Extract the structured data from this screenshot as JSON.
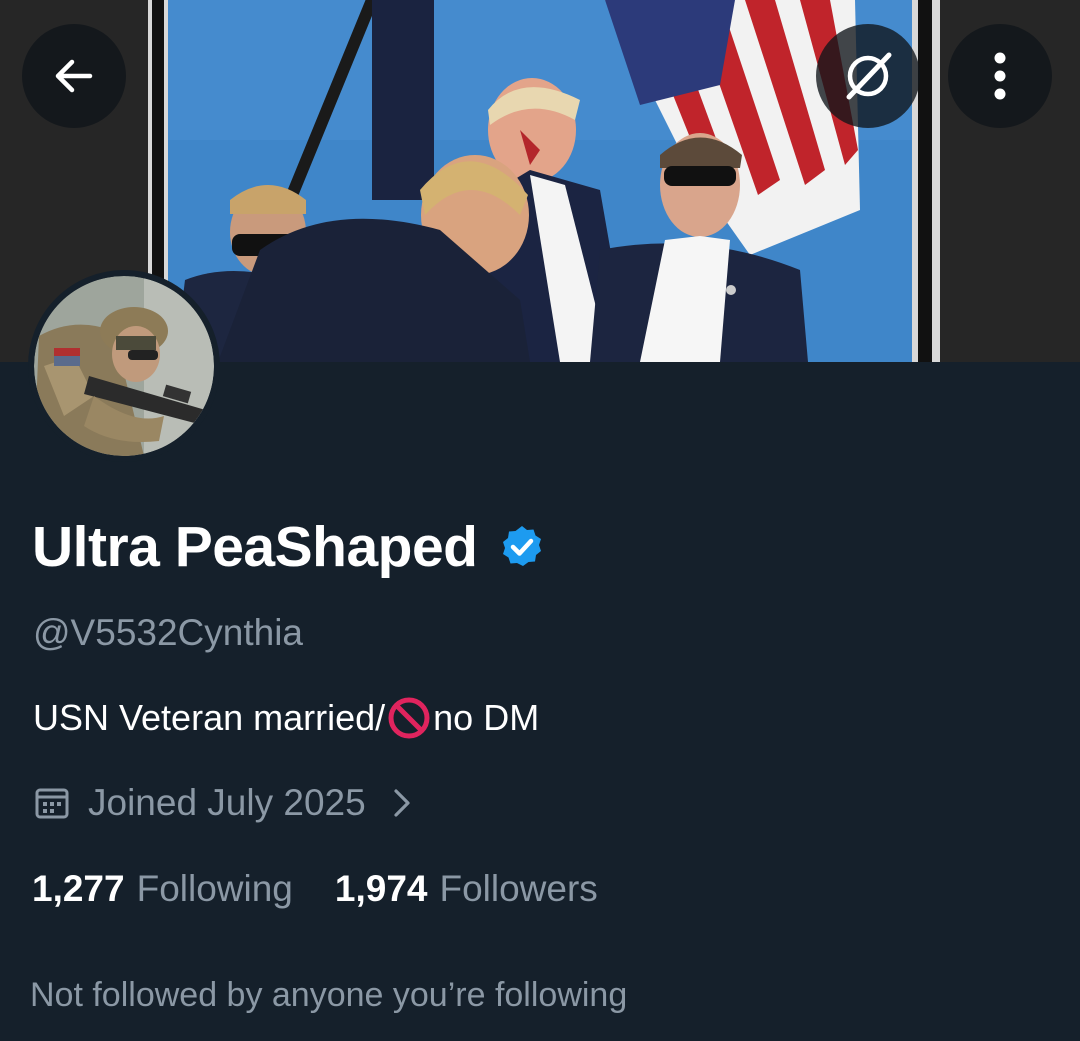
{
  "profile": {
    "display_name": "Ultra PeaShaped",
    "handle": "@V5532Cynthia",
    "bio_before": "USN Veteran married/",
    "bio_after": "no DM",
    "joined": "Joined July 2025",
    "following_count": "1,277",
    "following_label": "Following",
    "followers_count": "1,974",
    "followers_label": "Followers",
    "mutuals_note": "Not followed by anyone you’re following"
  },
  "icons": {
    "back": "arrow-left-icon",
    "grok": "grok-icon",
    "more": "more-vertical-icon",
    "verified": "verified-badge-icon",
    "calendar": "calendar-icon",
    "chevron": "chevron-right-icon",
    "no_entry": "no-entry-emoji"
  },
  "colors": {
    "background": "#15202b",
    "text_primary": "#ffffff",
    "text_secondary": "#8b98a5",
    "verified_blue": "#1d9bf0"
  }
}
